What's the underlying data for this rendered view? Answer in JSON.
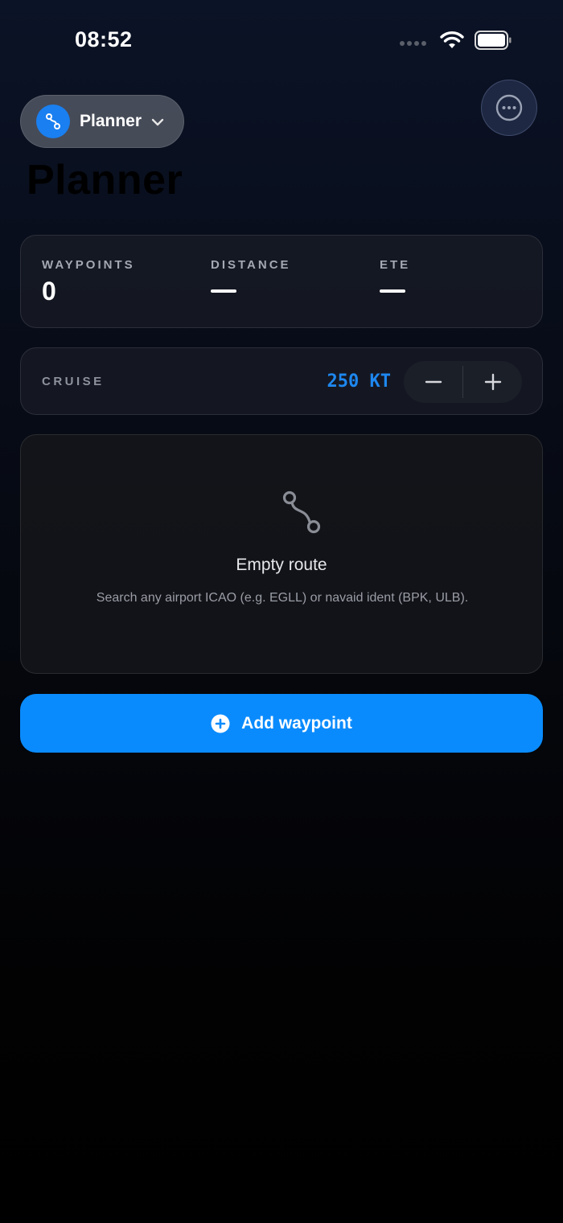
{
  "status_bar": {
    "time": "08:52",
    "icons": [
      "cellular-signal-icon",
      "wifi-icon",
      "battery-icon"
    ]
  },
  "header": {
    "menu_label": "Planner",
    "menu_icon": "route-icon",
    "more_icon": "ellipsis-circle-icon",
    "page_title": "Planner"
  },
  "stats": {
    "waypoints_label": "WAYPOINTS",
    "waypoints_value": "0",
    "distance_label": "DISTANCE",
    "ete_label": "ETE"
  },
  "cruise": {
    "label": "CRUISE",
    "value": "250 KT",
    "decrement_icon": "minus-icon",
    "increment_icon": "plus-icon"
  },
  "empty_state": {
    "title": "Empty route",
    "description": "Search any airport ICAO (e.g. EGLL) or navaid ident (BPK, ULB)."
  },
  "actions": {
    "add_waypoint_label": "Add waypoint"
  },
  "colors": {
    "accent": "#0a8bfd",
    "cruise_value": "#1e88f0",
    "background_top": "#0b1326",
    "background_bottom": "#000000"
  }
}
